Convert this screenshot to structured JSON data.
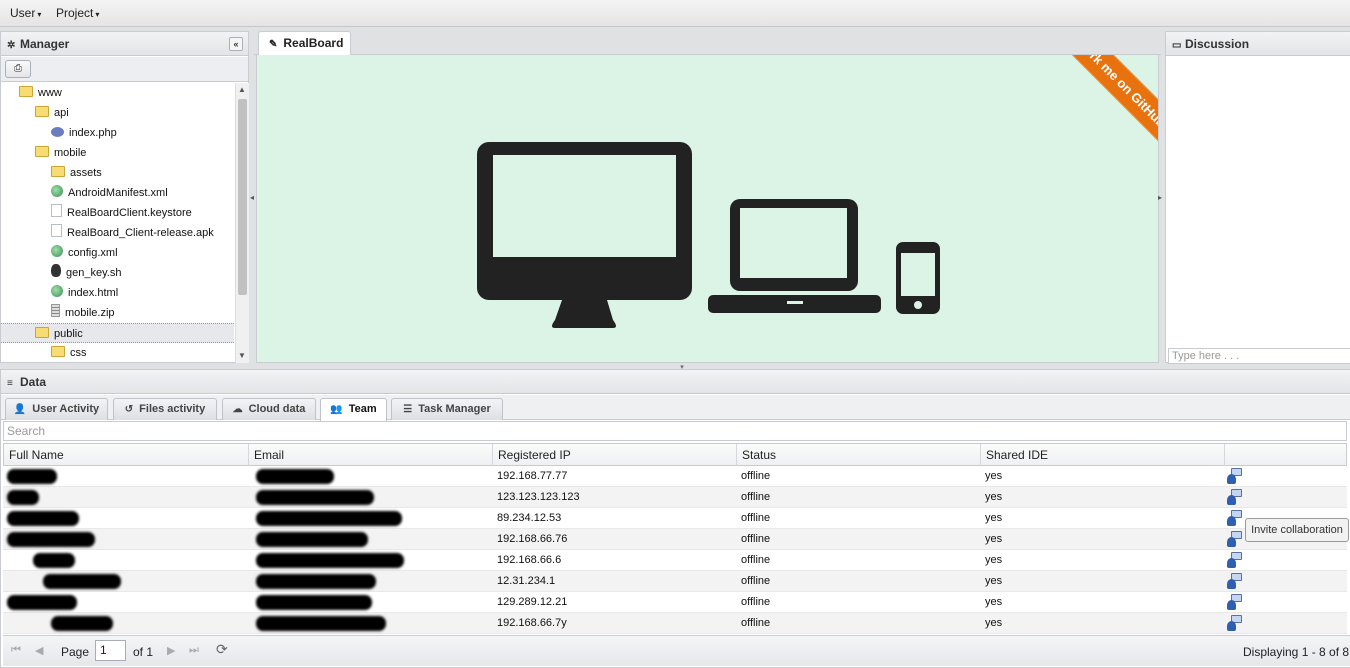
{
  "menubar": {
    "user": "User",
    "project": "Project",
    "caret": "▾"
  },
  "manager": {
    "title": "Manager",
    "collapse": "«",
    "tree": [
      {
        "label": "www",
        "type": "folder"
      },
      {
        "label": "api",
        "type": "folder"
      },
      {
        "label": "index.php",
        "type": "php"
      },
      {
        "label": "mobile",
        "type": "folder"
      },
      {
        "label": "assets",
        "type": "folder"
      },
      {
        "label": "AndroidManifest.xml",
        "type": "web"
      },
      {
        "label": "RealBoardClient.keystore",
        "type": "blank"
      },
      {
        "label": "RealBoard_Client-release.apk",
        "type": "blank"
      },
      {
        "label": "config.xml",
        "type": "web"
      },
      {
        "label": "gen_key.sh",
        "type": "sh"
      },
      {
        "label": "index.html",
        "type": "web"
      },
      {
        "label": "mobile.zip",
        "type": "zip"
      },
      {
        "label": "public",
        "type": "folder"
      },
      {
        "label": "css",
        "type": "folder"
      }
    ]
  },
  "realboard": {
    "tab": "RealBoard",
    "ribbon": "Fork me on GitHub"
  },
  "discussion": {
    "title": "Discussion",
    "placeholder": "Type here . . ."
  },
  "data": {
    "title": "Data",
    "tabs": [
      "User Activity",
      "Files activity",
      "Cloud data",
      "Team",
      "Task Manager"
    ],
    "active_tab": "Team",
    "search_placeholder": "Search",
    "columns": [
      "Full Name",
      "Email",
      "Registered IP",
      "Status",
      "Shared IDE"
    ],
    "rows": [
      {
        "name": "",
        "email": "",
        "ip": "192.168.77.77",
        "status": "offline",
        "shared": "yes"
      },
      {
        "name": "",
        "email": "",
        "ip": "123.123.123.123",
        "status": "offline",
        "shared": "yes"
      },
      {
        "name": "",
        "email": "",
        "ip": "89.234.12.53",
        "status": "offline",
        "shared": "yes"
      },
      {
        "name": "",
        "email": "",
        "ip": "192.168.66.76",
        "status": "offline",
        "shared": "yes"
      },
      {
        "name": "",
        "email": "",
        "ip": "192.168.66.6",
        "status": "offline",
        "shared": "yes"
      },
      {
        "name": "",
        "email": "",
        "ip": "12.31.234.1",
        "status": "offline",
        "shared": "yes"
      },
      {
        "name": "",
        "email": "",
        "ip": "129.289.12.21",
        "status": "offline",
        "shared": "yes"
      },
      {
        "name": "",
        "email": "",
        "ip": "192.168.66.7y",
        "status": "offline",
        "shared": "yes"
      }
    ],
    "tooltip": "Invite collaboration",
    "pager": {
      "page_label": "Page",
      "page_value": "1",
      "of_label": "of 1",
      "displaying": "Displaying 1 - 8 of 8"
    }
  }
}
